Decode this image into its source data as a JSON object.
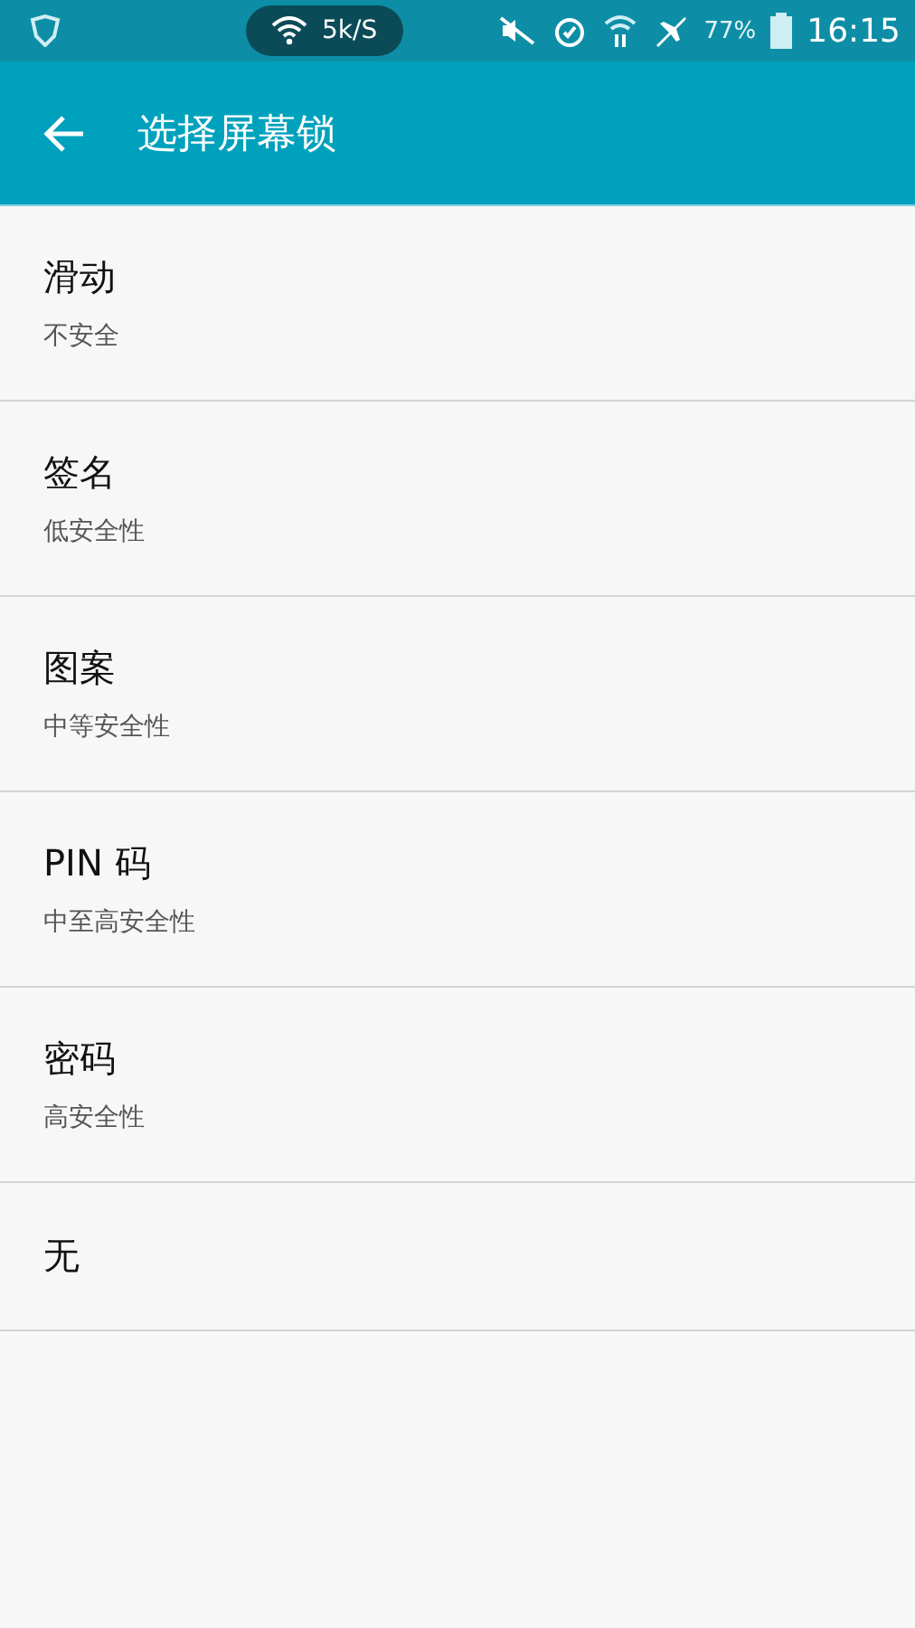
{
  "status_bar": {
    "speed": "5k/S",
    "battery": "77%",
    "time": "16:15"
  },
  "toolbar": {
    "title": "选择屏幕锁"
  },
  "options": [
    {
      "title": "滑动",
      "subtitle": "不安全"
    },
    {
      "title": "签名",
      "subtitle": "低安全性"
    },
    {
      "title": "图案",
      "subtitle": "中等安全性"
    },
    {
      "title": "PIN 码",
      "subtitle": "中至高安全性"
    },
    {
      "title": "密码",
      "subtitle": "高安全性"
    },
    {
      "title": "无"
    }
  ]
}
